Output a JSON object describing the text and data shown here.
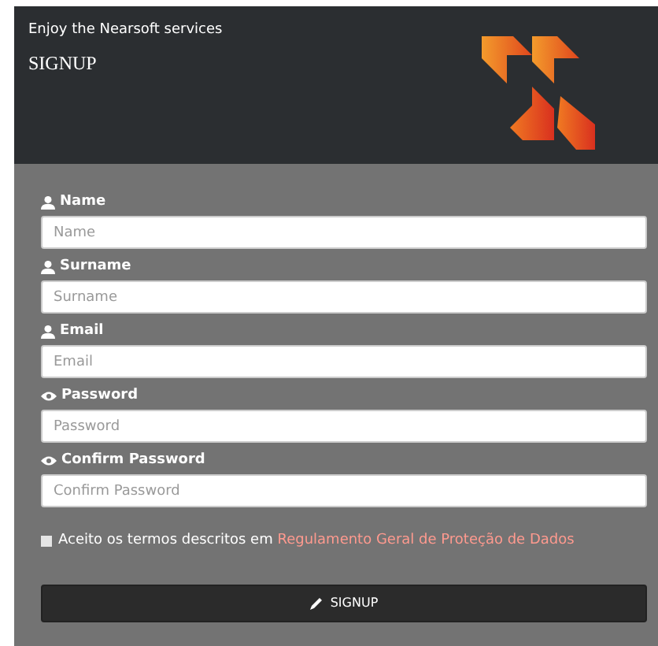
{
  "header": {
    "subtitle": "Enjoy the Nearsoft services",
    "title": "SIGNUP"
  },
  "fields": [
    {
      "kind": "user",
      "label": "Name",
      "placeholder": "Name"
    },
    {
      "kind": "user",
      "label": "Surname",
      "placeholder": "Surname"
    },
    {
      "kind": "user",
      "label": "Email",
      "placeholder": "Email"
    },
    {
      "kind": "eye",
      "label": "Password",
      "placeholder": "Password"
    },
    {
      "kind": "eye",
      "label": "Confirm Password",
      "placeholder": "Confirm Password"
    }
  ],
  "terms": {
    "checked": false,
    "text": "Aceito os termos descritos em",
    "link": "Regulamento Geral de Proteção de Dados"
  },
  "submit": {
    "label": "SIGNUP"
  }
}
